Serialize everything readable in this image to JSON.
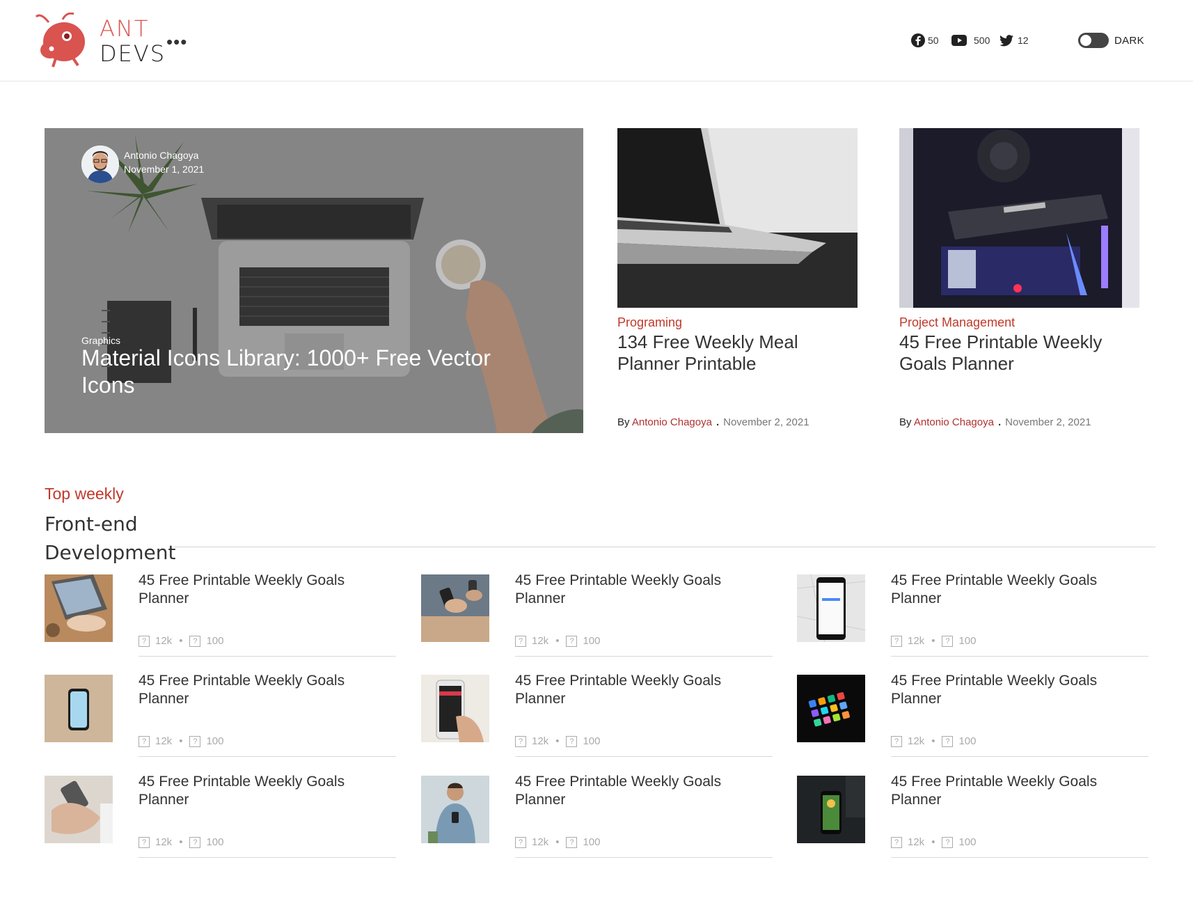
{
  "brand": {
    "word1": "ANT",
    "word2": "DEVS",
    "more": "•••"
  },
  "social": {
    "facebook_count": "50",
    "youtube_count": "500",
    "twitter_count": "12"
  },
  "theme_toggle": {
    "label": "DARK"
  },
  "hero": {
    "author": "Antonio Chagoya",
    "date": "November 1, 2021",
    "category": "Graphics",
    "title": "Material Icons Library: 1000+ Free Vector Icons"
  },
  "cards": [
    {
      "category": "Programing",
      "title": "134 Free Weekly Meal Planner Printable",
      "by": "By",
      "author": "Antonio Chagoya",
      "sep": ".",
      "date": "November 2, 2021"
    },
    {
      "category": "Project Management",
      "title": "45 Free Printable Weekly Goals Planner",
      "by": "By",
      "author": "Antonio Chagoya",
      "sep": ".",
      "date": "November 2, 2021"
    }
  ],
  "section": {
    "label": "Top weekly",
    "title": "Front-end Development"
  },
  "items": [
    {
      "title": "45 Free Printable Weekly Goals Planner",
      "views": "12k",
      "comments": "100"
    },
    {
      "title": "45 Free Printable Weekly Goals Planner",
      "views": "12k",
      "comments": "100"
    },
    {
      "title": "45 Free Printable Weekly Goals Planner",
      "views": "12k",
      "comments": "100"
    },
    {
      "title": "45 Free Printable Weekly Goals Planner",
      "views": "12k",
      "comments": "100"
    },
    {
      "title": "45 Free Printable Weekly Goals Planner",
      "views": "12k",
      "comments": "100"
    },
    {
      "title": "45 Free Printable Weekly Goals Planner",
      "views": "12k",
      "comments": "100"
    },
    {
      "title": "45 Free Printable Weekly Goals Planner",
      "views": "12k",
      "comments": "100"
    },
    {
      "title": "45 Free Printable Weekly Goals Planner",
      "views": "12k",
      "comments": "100"
    },
    {
      "title": "45 Free Printable Weekly Goals Planner",
      "views": "12k",
      "comments": "100"
    }
  ],
  "colors": {
    "accent": "#c0392b",
    "brand": "#d9534f"
  }
}
